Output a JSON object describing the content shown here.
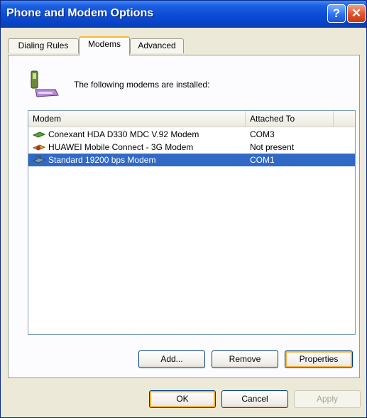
{
  "window": {
    "title": "Phone and Modem Options",
    "help_label": "?",
    "close_label": "✕"
  },
  "tabs": [
    {
      "label": "Dialing Rules",
      "active": false
    },
    {
      "label": "Modems",
      "active": true
    },
    {
      "label": "Advanced",
      "active": false
    }
  ],
  "intro_text": "The following modems are installed:",
  "table": {
    "columns": [
      "Modem",
      "Attached To"
    ],
    "rows": [
      {
        "icon": "modem-icon",
        "name": "Conexant HDA D330 MDC V.92 Modem",
        "port": "COM3",
        "selected": false
      },
      {
        "icon": "modem-icon",
        "name": "HUAWEI Mobile Connect - 3G Modem",
        "port": "Not present",
        "selected": false
      },
      {
        "icon": "modem-icon",
        "name": "Standard 19200 bps Modem",
        "port": "COM1",
        "selected": true
      }
    ]
  },
  "panel_buttons": {
    "add": "Add...",
    "remove": "Remove",
    "properties": "Properties"
  },
  "dialog_buttons": {
    "ok": "OK",
    "cancel": "Cancel",
    "apply": "Apply"
  },
  "colors": {
    "title_bar": "#0a4bd6",
    "selection": "#316ac5",
    "focus": "#f8b33d"
  }
}
